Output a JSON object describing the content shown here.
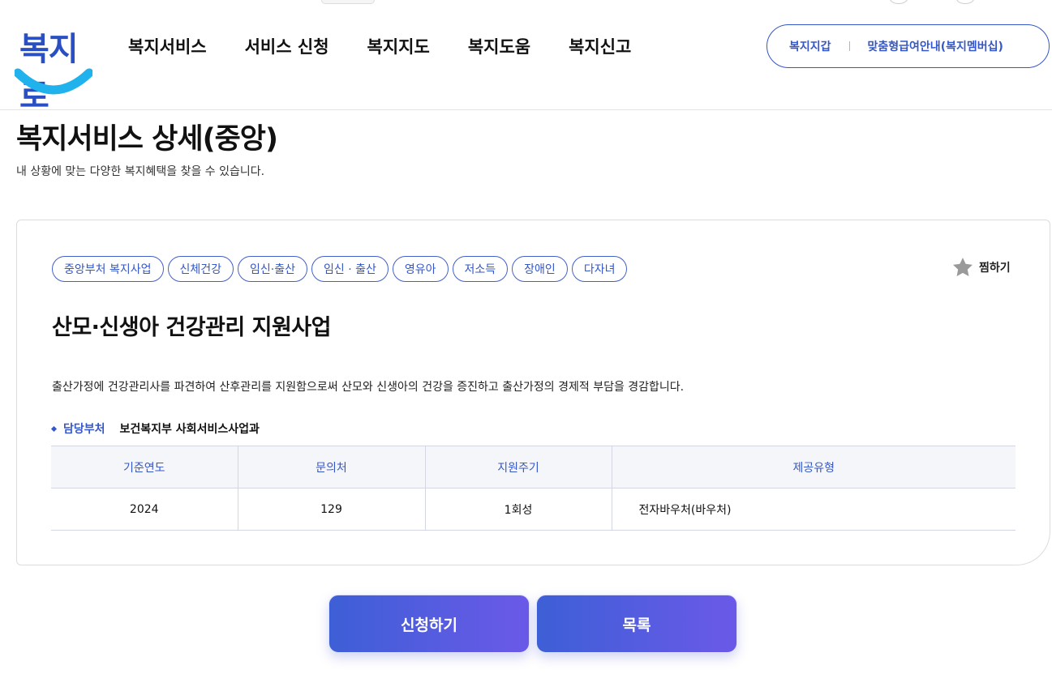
{
  "header": {
    "logo_text": "복지로",
    "nav": [
      "복지서비스",
      "서비스 신청",
      "복지지도",
      "복지도움",
      "복지신고"
    ],
    "util_links": [
      "복지지갑",
      "맞춤형급여안내(복지멤버십)"
    ]
  },
  "page": {
    "title": "복지서비스 상세(중앙)",
    "subtitle": "내 상황에 맞는 다양한 복지혜택을 찾을 수 있습니다."
  },
  "service": {
    "tags": [
      "중앙부처 복지사업",
      "신체건강",
      "임신·출산",
      "임신 · 출산",
      "영유아",
      "저소득",
      "장애인",
      "다자녀"
    ],
    "wish_label": "찜하기",
    "title": "산모·신생아 건강관리 지원사업",
    "description": "출산가정에 건강관리사를 파견하여 산후관리를 지원함으로써 산모와 신생아의 건강을 증진하고 출산가정의 경제적 부담을 경감합니다.",
    "dept_label": "담당부처",
    "dept_value": "보건복지부 사회서비스사업과",
    "table": {
      "headers": [
        "기준연도",
        "문의처",
        "지원주기",
        "제공유형"
      ],
      "row": [
        "2024",
        "129",
        "1회성",
        "전자바우처(바우처)"
      ]
    }
  },
  "actions": {
    "apply_label": "신청하기",
    "list_label": "목록"
  },
  "colors": {
    "accent": "#3557c7",
    "logo_smile": "#1fb2ec",
    "button_gradient_start": "#3d5fd6",
    "button_gradient_end": "#6b59e8",
    "star": "#9a9a9a"
  },
  "icons": {
    "wish": "star-icon",
    "dept_bullet": "diamond-bullet-icon"
  }
}
